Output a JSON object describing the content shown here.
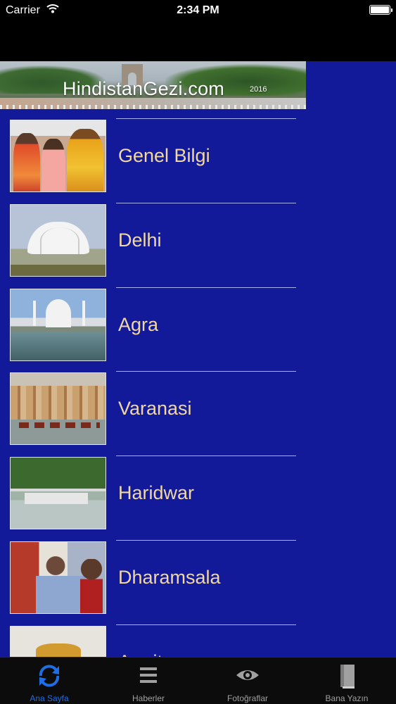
{
  "status_bar": {
    "carrier": "Carrier",
    "time": "2:34 PM"
  },
  "banner": {
    "brand": "HindistanGezi.com",
    "year": "2016"
  },
  "list": [
    {
      "label": "Genel Bilgi",
      "thumb": "women-in-saris-photo"
    },
    {
      "label": "Delhi",
      "thumb": "lotus-temple-photo"
    },
    {
      "label": "Agra",
      "thumb": "taj-mahal-photo"
    },
    {
      "label": "Varanasi",
      "thumb": "ganges-ghats-photo"
    },
    {
      "label": "Haridwar",
      "thumb": "haridwar-bridge-photo"
    },
    {
      "label": "Dharamsala",
      "thumb": "prayer-wheel-photo"
    },
    {
      "label": "Amritsar",
      "thumb": "golden-temple-photo"
    }
  ],
  "tabs": [
    {
      "label": "Ana Sayfa",
      "icon": "refresh-icon",
      "active": true
    },
    {
      "label": "Haberler",
      "icon": "list-icon",
      "active": false
    },
    {
      "label": "Fotoğraflar",
      "icon": "eye-icon",
      "active": false
    },
    {
      "label": "Bana Yazın",
      "icon": "book-icon",
      "active": false
    }
  ],
  "colors": {
    "content_bg": "#131a9a",
    "label_text": "#f1d7a1",
    "tab_active": "#1e6ee6",
    "tab_inactive": "#a0a0a0"
  }
}
